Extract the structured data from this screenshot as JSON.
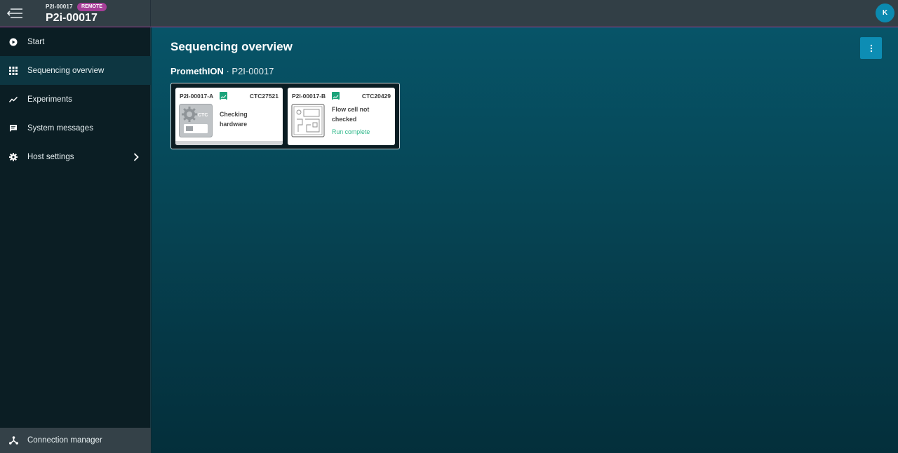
{
  "header": {
    "device_small": "P2I-00017",
    "badge": "REMOTE",
    "device_title": "P2i-00017",
    "user_initial": "K"
  },
  "sidebar": {
    "items": [
      {
        "label": "Start",
        "icon": "play-circle-icon"
      },
      {
        "label": "Sequencing overview",
        "icon": "grid-icon"
      },
      {
        "label": "Experiments",
        "icon": "trend-line-icon"
      },
      {
        "label": "System messages",
        "icon": "message-icon"
      },
      {
        "label": "Host settings",
        "icon": "gear-icon"
      }
    ],
    "active": "Sequencing overview",
    "footer_label": "Connection manager",
    "footer_icon": "network-icon"
  },
  "main": {
    "title": "Sequencing overview",
    "device_type": "PromethION",
    "device_separator": " · ",
    "device_name": "P2I-00017",
    "positions": [
      {
        "position": "P2I-00017-A",
        "flow_cell_id": "CTC27521",
        "status": "Checking hardware",
        "status_line1": "Checking",
        "status_line2": "hardware",
        "substatus": "",
        "icon": "ctc-icon",
        "icon_text": "CTC"
      },
      {
        "position": "P2I-00017-B",
        "flow_cell_id": "CTC20429",
        "status": "Flow cell not checked",
        "status_line1": "Flow cell not",
        "status_line2": "checked",
        "substatus": "Run complete",
        "icon": "flow-cell-icon"
      }
    ]
  },
  "colors": {
    "accent": "#0d8db4",
    "badge": "#a63f98",
    "position_chip": "#1ba37a",
    "run_complete": "#2fb88a",
    "sidebar_bg": "#0b1e24",
    "topbar_bg": "#323f46"
  }
}
